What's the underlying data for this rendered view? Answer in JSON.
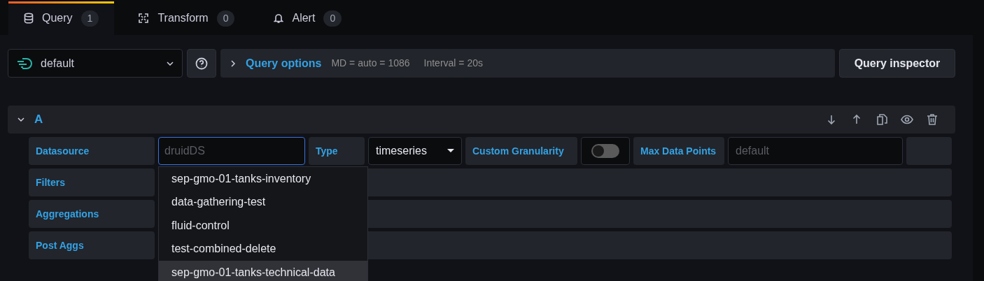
{
  "tabs": [
    {
      "label": "Query",
      "count": "1",
      "kind": "database",
      "selected": true
    },
    {
      "label": "Transform",
      "count": "0",
      "kind": "transform",
      "selected": false
    },
    {
      "label": "Alert",
      "count": "0",
      "kind": "bell",
      "selected": false
    }
  ],
  "toolbar": {
    "datasource": "default",
    "query_options": {
      "title": "Query options",
      "expanded": false,
      "max_data_points": "MD = auto = 1086",
      "interval": "Interval = 20s"
    },
    "inspector_button": "Query inspector"
  },
  "query": {
    "ref": "A",
    "expanded": true,
    "datasource_label": "Datasource",
    "datasource_placeholder": "druidDS",
    "type_label": "Type",
    "type_value": "timeseries",
    "granularity_label": "Custom Granularity",
    "granularity_on": false,
    "max_points_label": "Max Data Points",
    "max_points_placeholder": "default",
    "rows": [
      "Filters",
      "Aggregations",
      "Post Aggs"
    ]
  },
  "dropdown": [
    {
      "label": "sep-gmo-01-tanks-inventory",
      "selected": false
    },
    {
      "label": "data-gathering-test",
      "selected": false
    },
    {
      "label": "fluid-control",
      "selected": false
    },
    {
      "label": "test-combined-delete",
      "selected": false
    },
    {
      "label": "sep-gmo-01-tanks-technical-data",
      "selected": true
    }
  ]
}
